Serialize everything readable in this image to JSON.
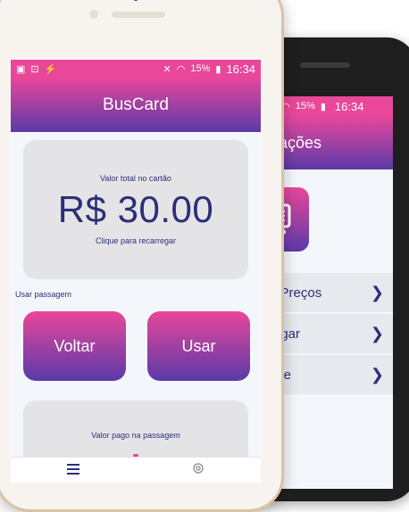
{
  "front": {
    "status": {
      "time": "16:34",
      "battery": "15%"
    },
    "app_title": "BusCard",
    "balance": {
      "label": "Valor total no cartão",
      "amount": "R$ 30.00",
      "cta": "Clique para recarregar"
    },
    "section_label": "Usar passagem",
    "buttons": {
      "back": "Voltar",
      "use": "Usar"
    },
    "paid": {
      "label": "Valor pago na passagem"
    },
    "nav": {
      "items": [
        {
          "icon": "menu-icon"
        },
        {
          "icon": "gear-icon"
        }
      ]
    }
  },
  "back": {
    "status": {
      "time": "16:34",
      "battery": "15%"
    },
    "header_partial": "urações",
    "menu": [
      {
        "label": "ar Preços"
      },
      {
        "label": "rregar"
      },
      {
        "label": "obre"
      }
    ]
  },
  "colors": {
    "accent_pink": "#e8479a",
    "accent_purple": "#5a3aa8",
    "text_navy": "#2b2f78",
    "card_gray": "#e4e4e6"
  }
}
